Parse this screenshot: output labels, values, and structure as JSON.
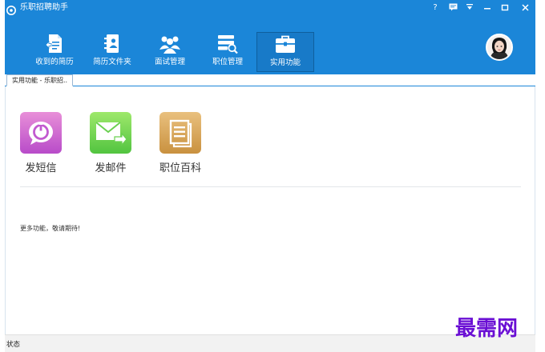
{
  "window": {
    "title": "乐职招聘助手",
    "controls": [
      "?",
      "message-icon",
      "menu-icon",
      "minimize-icon",
      "maximize-icon",
      "close-icon"
    ]
  },
  "colors": {
    "header_bg": "#1b86d8",
    "tile_sms": "#c25ad0",
    "tile_mail": "#6ad050",
    "tile_wiki": "#d9a557",
    "watermark": "#6a0fd4"
  },
  "nav": {
    "items": [
      {
        "label": "收到的简历",
        "icon": "inbox-resume-icon"
      },
      {
        "label": "简历文件夹",
        "icon": "resume-folder-icon"
      },
      {
        "label": "面试管理",
        "icon": "people-group-icon"
      },
      {
        "label": "职位管理",
        "icon": "job-search-icon"
      },
      {
        "label": "实用功能",
        "icon": "toolbox-icon",
        "active": true
      }
    ]
  },
  "tabs": [
    {
      "label": "实用功能 - 乐职招.."
    }
  ],
  "tools": [
    {
      "label": "发短信",
      "icon": "sms-power-icon"
    },
    {
      "label": "发邮件",
      "icon": "mail-send-icon"
    },
    {
      "label": "职位百科",
      "icon": "document-list-icon"
    }
  ],
  "content": {
    "more_text": "更多功能，敬请期待!"
  },
  "status": {
    "text": "状态"
  },
  "watermark": "最需网"
}
